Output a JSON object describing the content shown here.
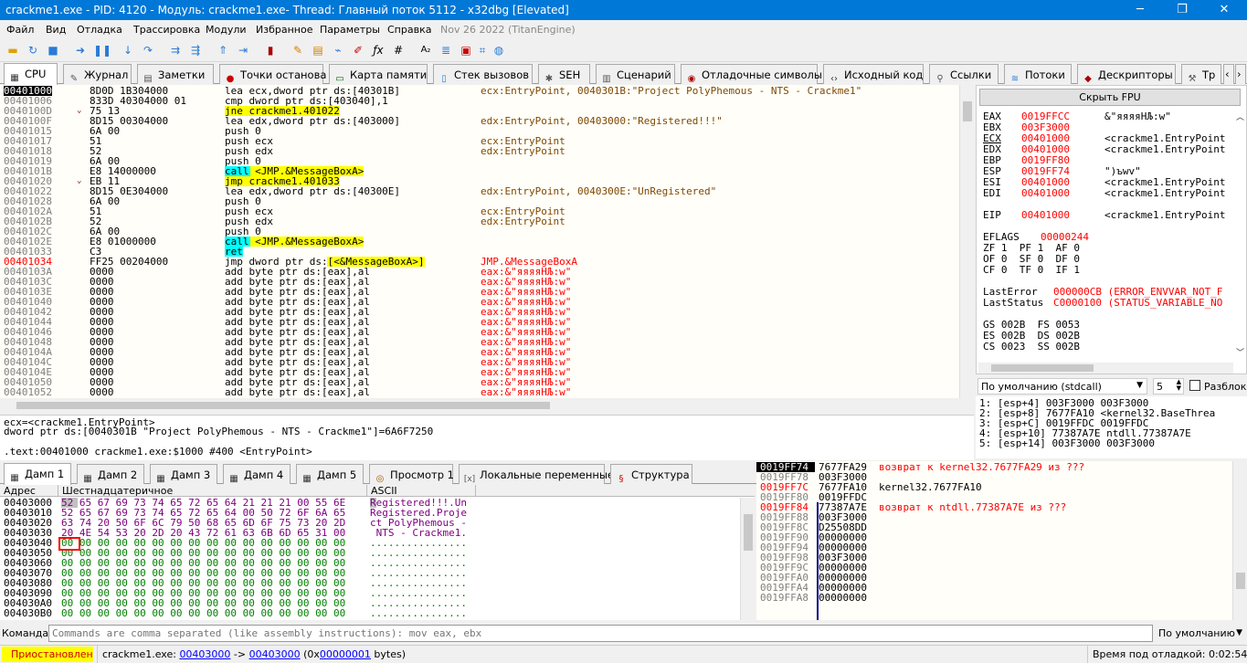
{
  "window": {
    "title": "crackme1.exe - PID: 4120 - Модуль: crackme1.exe- Thread: Главный поток 5112 - x32dbg [Elevated]",
    "min": "─",
    "max": "❐",
    "close": "✕"
  },
  "menu": [
    "Файл",
    "Вид",
    "Отладка",
    "Трассировка",
    "Модули",
    "Избранное",
    "Параметры",
    "Справка",
    "Nov 26 2022 (TitanEngine)"
  ],
  "tabs": [
    "CPU",
    "Журнал",
    "Заметки",
    "Точки останова",
    "Карта памяти",
    "Стек вызовов",
    "SEH",
    "Сценарий",
    "Отладочные символы",
    "Исходный код",
    "Ссылки",
    "Потоки",
    "Дескрипторы",
    "Тр"
  ],
  "disasm": [
    {
      "a": "00401000",
      "ar": "",
      "b": "8D0D 1B304000",
      "i": "lea ecx,dword ptr ds:[40301B]",
      "c": "ecx:EntryPoint, 0040301B:\"Project PolyPhemous - NTS - Crackme1\""
    },
    {
      "a": "00401006",
      "ar": "",
      "b": "833D 40304000 01",
      "i": "cmp dword ptr ds:[403040],1",
      "c": ""
    },
    {
      "a": "0040100D",
      "ar": "⌄",
      "b": "75 13",
      "i": "jne crackme1.401022",
      "c": ""
    },
    {
      "a": "0040100F",
      "ar": "",
      "b": "8D15 00304000",
      "i": "lea edx,dword ptr ds:[403000]",
      "c": "edx:EntryPoint, 00403000:\"Registered!!!\""
    },
    {
      "a": "00401015",
      "ar": "",
      "b": "6A 00",
      "i": "push 0",
      "c": ""
    },
    {
      "a": "00401017",
      "ar": "",
      "b": "51",
      "i": "push ecx",
      "c": "ecx:EntryPoint"
    },
    {
      "a": "00401018",
      "ar": "",
      "b": "52",
      "i": "push edx",
      "c": "edx:EntryPoint"
    },
    {
      "a": "00401019",
      "ar": "",
      "b": "6A 00",
      "i": "push 0",
      "c": ""
    },
    {
      "a": "0040101B",
      "ar": "",
      "b": "E8 14000000",
      "i": "call <JMP.&MessageBoxA>",
      "c": ""
    },
    {
      "a": "00401020",
      "ar": "⌄",
      "b": "EB 11",
      "i": "jmp crackme1.401033",
      "c": ""
    },
    {
      "a": "00401022",
      "ar": "",
      "b": "8D15 0E304000",
      "i": "lea edx,dword ptr ds:[40300E]",
      "c": "edx:EntryPoint, 0040300E:\"UnRegistered\""
    },
    {
      "a": "00401028",
      "ar": "",
      "b": "6A 00",
      "i": "push 0",
      "c": ""
    },
    {
      "a": "0040102A",
      "ar": "",
      "b": "51",
      "i": "push ecx",
      "c": "ecx:EntryPoint"
    },
    {
      "a": "0040102B",
      "ar": "",
      "b": "52",
      "i": "push edx",
      "c": "edx:EntryPoint"
    },
    {
      "a": "0040102C",
      "ar": "",
      "b": "6A 00",
      "i": "push 0",
      "c": ""
    },
    {
      "a": "0040102E",
      "ar": "",
      "b": "E8 01000000",
      "i": "call <JMP.&MessageBoxA>",
      "c": ""
    },
    {
      "a": "00401033",
      "ar": "",
      "b": "C3",
      "i": "ret",
      "c": ""
    },
    {
      "a": "00401034",
      "ar": "",
      "b": "FF25 00204000",
      "i": "jmp dword ptr ds:[<&MessageBoxA>]",
      "c": "JMP.&MessageBoxA"
    },
    {
      "a": "0040103A",
      "ar": "",
      "b": "0000",
      "i": "add byte ptr ds:[eax],al",
      "c": "eax:&\"яяяяНЉ:w\""
    },
    {
      "a": "0040103C",
      "ar": "",
      "b": "0000",
      "i": "add byte ptr ds:[eax],al",
      "c": "eax:&\"яяяяНЉ:w\""
    },
    {
      "a": "0040103E",
      "ar": "",
      "b": "0000",
      "i": "add byte ptr ds:[eax],al",
      "c": "eax:&\"яяяяНЉ:w\""
    },
    {
      "a": "00401040",
      "ar": "",
      "b": "0000",
      "i": "add byte ptr ds:[eax],al",
      "c": "eax:&\"яяяяНЉ:w\""
    },
    {
      "a": "00401042",
      "ar": "",
      "b": "0000",
      "i": "add byte ptr ds:[eax],al",
      "c": "eax:&\"яяяяНЉ:w\""
    },
    {
      "a": "00401044",
      "ar": "",
      "b": "0000",
      "i": "add byte ptr ds:[eax],al",
      "c": "eax:&\"яяяяНЉ:w\""
    },
    {
      "a": "00401046",
      "ar": "",
      "b": "0000",
      "i": "add byte ptr ds:[eax],al",
      "c": "eax:&\"яяяяНЉ:w\""
    },
    {
      "a": "00401048",
      "ar": "",
      "b": "0000",
      "i": "add byte ptr ds:[eax],al",
      "c": "eax:&\"яяяяНЉ:w\""
    },
    {
      "a": "0040104A",
      "ar": "",
      "b": "0000",
      "i": "add byte ptr ds:[eax],al",
      "c": "eax:&\"яяяяНЉ:w\""
    },
    {
      "a": "0040104C",
      "ar": "",
      "b": "0000",
      "i": "add byte ptr ds:[eax],al",
      "c": "eax:&\"яяяяНЉ:w\""
    },
    {
      "a": "0040104E",
      "ar": "",
      "b": "0000",
      "i": "add byte ptr ds:[eax],al",
      "c": "eax:&\"яяяяНЉ:w\""
    },
    {
      "a": "00401050",
      "ar": "",
      "b": "0000",
      "i": "add byte ptr ds:[eax],al",
      "c": "eax:&\"яяяяНЉ:w\""
    },
    {
      "a": "00401052",
      "ar": "",
      "b": "0000",
      "i": "add byte ptr ds:[eax],al",
      "c": "eax:&\"яяяяНЉ:w\""
    }
  ],
  "regs": {
    "hide_fpu": "Скрыть FPU",
    "lines": [
      [
        "EAX",
        "0019FFCC",
        "&\"яяяяНЉ:w\""
      ],
      [
        "EBX",
        "003F3000",
        ""
      ],
      [
        "ECX",
        "00401000",
        "<crackme1.EntryPoint"
      ],
      [
        "EDX",
        "00401000",
        "<crackme1.EntryPoint"
      ],
      [
        "EBP",
        "0019FF80",
        ""
      ],
      [
        "ESP",
        "0019FF74",
        "\")ъwv\""
      ],
      [
        "ESI",
        "00401000",
        "<crackme1.EntryPoint"
      ],
      [
        "EDI",
        "00401000",
        "<crackme1.EntryPoint"
      ],
      [
        "EIP",
        "00401000",
        "<crackme1.EntryPoint"
      ]
    ],
    "eflags_label": "EFLAGS",
    "eflags": "00000244",
    "flags": [
      "ZF 1  PF 1  AF 0",
      "OF 0  SF 0  DF 0",
      "CF 0  TF 0  IF 1"
    ],
    "lasterror_label": "LastError",
    "lasterror": "000000CB (ERROR_ENVVAR_NOT_F",
    "laststatus_label": "LastStatus",
    "laststatus": "C0000100 (STATUS_VARIABLE_NO",
    "segs": [
      "GS 002B  FS 0053",
      "ES 002B  DS 002B",
      "CS 0023  SS 002B"
    ]
  },
  "callconv": {
    "select": "По умолчанию (stdcall)",
    "count": "5",
    "unlock": "Разблок",
    "args": [
      "1: [esp+4] 003F3000 003F3000",
      "2: [esp+8] 7677FA10 <kernel32.BaseThrea",
      "3: [esp+C] 0019FFDC 0019FFDC",
      "4: [esp+10] 77387A7E ntdll.77387A7E",
      "5: [esp+14] 003F3000 003F3000"
    ]
  },
  "info": [
    "ecx=<crackme1.EntryPoint>",
    "dword ptr ds:[0040301B \"Project PolyPhemous - NTS - Crackme1\"]=6A6F7250",
    "",
    ".text:00401000 crackme1.exe:$1000 #400 <EntryPoint>"
  ],
  "dumptabs": [
    "Дамп 1",
    "Дамп 2",
    "Дамп 3",
    "Дамп 4",
    "Дамп 5",
    "Просмотр 1",
    "Локальные переменные",
    "Структура"
  ],
  "dump": {
    "h_addr": "Адрес",
    "h_hex": "Шестнадцатеричное",
    "h_ascii": "ASCII",
    "rows": [
      [
        "00403000",
        "52 65 67 69 73 74 65 72 65 64 21 21 21 00 55 6E",
        "Registered!!!.Un"
      ],
      [
        "00403010",
        "52 65 67 69 73 74 65 72 65 64 00 50 72 6F 6A 65",
        "Registered.Proje"
      ],
      [
        "00403020",
        "63 74 20 50 6F 6C 79 50 68 65 6D 6F 75 73 20 2D",
        "ct PolyPhemous -"
      ],
      [
        "00403030",
        "20 4E 54 53 20 2D 20 43 72 61 63 6B 6D 65 31 00",
        " NTS - Crackme1."
      ],
      [
        "00403040",
        "00 00 00 00 00 00 00 00 00 00 00 00 00 00 00 00",
        "................"
      ],
      [
        "00403050",
        "00 00 00 00 00 00 00 00 00 00 00 00 00 00 00 00",
        "................"
      ],
      [
        "00403060",
        "00 00 00 00 00 00 00 00 00 00 00 00 00 00 00 00",
        "................"
      ],
      [
        "00403070",
        "00 00 00 00 00 00 00 00 00 00 00 00 00 00 00 00",
        "................"
      ],
      [
        "00403080",
        "00 00 00 00 00 00 00 00 00 00 00 00 00 00 00 00",
        "................"
      ],
      [
        "00403090",
        "00 00 00 00 00 00 00 00 00 00 00 00 00 00 00 00",
        "................"
      ],
      [
        "004030A0",
        "00 00 00 00 00 00 00 00 00 00 00 00 00 00 00 00",
        "................"
      ],
      [
        "004030B0",
        "00 00 00 00 00 00 00 00 00 00 00 00 00 00 00 00",
        "................"
      ]
    ]
  },
  "stack": [
    [
      "0019FF74",
      "7677FA29",
      "возврат к kernel32.7677FA29 из ???"
    ],
    [
      "0019FF78",
      "003F3000",
      ""
    ],
    [
      "0019FF7C",
      "7677FA10",
      "kernel32.7677FA10"
    ],
    [
      "0019FF80",
      "0019FFDC",
      ""
    ],
    [
      "0019FF84",
      "77387A7E",
      "возврат к ntdll.77387A7E из ???"
    ],
    [
      "0019FF88",
      "003F3000",
      ""
    ],
    [
      "0019FF8C",
      "D25508DD",
      ""
    ],
    [
      "0019FF90",
      "00000000",
      ""
    ],
    [
      "0019FF94",
      "00000000",
      ""
    ],
    [
      "0019FF98",
      "003F3000",
      ""
    ],
    [
      "0019FF9C",
      "00000000",
      ""
    ],
    [
      "0019FFA0",
      "00000000",
      ""
    ],
    [
      "0019FFA4",
      "00000000",
      ""
    ],
    [
      "0019FFA8",
      "00000000",
      ""
    ]
  ],
  "cmd": {
    "label": "Команда:",
    "placeholder": "Commands are comma separated (like assembly instructions): mov eax, ebx",
    "mode": "По умолчанию"
  },
  "status": {
    "state": "Приостановлен",
    "p1": "crackme1.exe: ",
    "a1": "00403000",
    "p2": " -> ",
    "a2": "00403000",
    "p3": " (0x",
    "n": "00000001",
    "p4": " bytes)",
    "time": "Время под отладкой: 0:02:54:29"
  }
}
